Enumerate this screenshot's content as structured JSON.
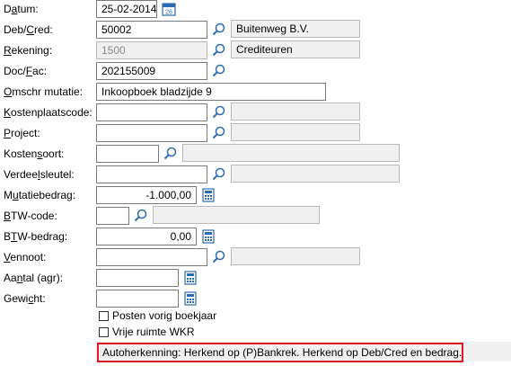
{
  "fields": {
    "datum": {
      "label_pre": "D",
      "label_ul": "a",
      "label_post": "tum:",
      "value": "25-02-2014"
    },
    "debcred": {
      "label_pre": "Deb/",
      "label_ul": "C",
      "label_post": "red:",
      "value": "50002",
      "description": "Buitenweg B.V."
    },
    "rekening": {
      "label_pre": "",
      "label_ul": "R",
      "label_post": "ekening:",
      "value": "1500",
      "description": "Crediteuren"
    },
    "docfac": {
      "label_pre": "Doc/",
      "label_ul": "F",
      "label_post": "ac:",
      "value": "202155009"
    },
    "omschr": {
      "label_pre": "",
      "label_ul": "O",
      "label_post": "mschr mutatie:",
      "value": "Inkoopboek bladzijde 9"
    },
    "kostenplaats": {
      "label_pre": "",
      "label_ul": "K",
      "label_post": "ostenplaatscode:",
      "value": "",
      "description": ""
    },
    "project": {
      "label_pre": "",
      "label_ul": "P",
      "label_post": "roject:",
      "value": "",
      "description": ""
    },
    "kostensoort": {
      "label_pre": "Kosten",
      "label_ul": "s",
      "label_post": "oort:",
      "value": "",
      "description": ""
    },
    "verdeelsleutel": {
      "label_pre": "Verdee",
      "label_ul": "l",
      "label_post": "sleutel:",
      "value": "",
      "description": ""
    },
    "mutatiebedrag": {
      "label_pre": "M",
      "label_ul": "u",
      "label_post": "tatiebedrag:",
      "value": "-1.000,00"
    },
    "btwcode": {
      "label_pre": "",
      "label_ul": "B",
      "label_post": "TW-code:",
      "value": "",
      "description": ""
    },
    "btwbedrag": {
      "label_pre": "B",
      "label_ul": "T",
      "label_post": "W-bedrag:",
      "value": "0,00"
    },
    "vennoot": {
      "label_pre": "",
      "label_ul": "V",
      "label_post": "ennoot:",
      "value": "",
      "description": ""
    },
    "aantal": {
      "label_pre": "Aa",
      "label_ul": "n",
      "label_post": "tal (agr):",
      "value": ""
    },
    "gewicht": {
      "label_pre": "Gewi",
      "label_ul": "c",
      "label_post": "ht:",
      "value": ""
    }
  },
  "checkboxes": {
    "posten_vorig": {
      "label_pre": "Posten vori",
      "label_ul": "g",
      "label_post": " boekjaar",
      "checked": false
    },
    "vrije_ruimte": {
      "label": "Vrije ruimte WKR",
      "checked": false
    }
  },
  "status": {
    "text": "Autoherkenning: Herkend op (P)Bankrek. Herkend op Deb/Cred en bedrag."
  },
  "calendar_icon_day": "26",
  "icons": {
    "lookup": "magnifier-icon",
    "calendar": "calendar-icon",
    "calculator": "calculator-icon"
  },
  "colors": {
    "status_border": "#e0181f",
    "readonly_bg": "#f0f0f0",
    "icon_blue": "#2b6cb0"
  }
}
